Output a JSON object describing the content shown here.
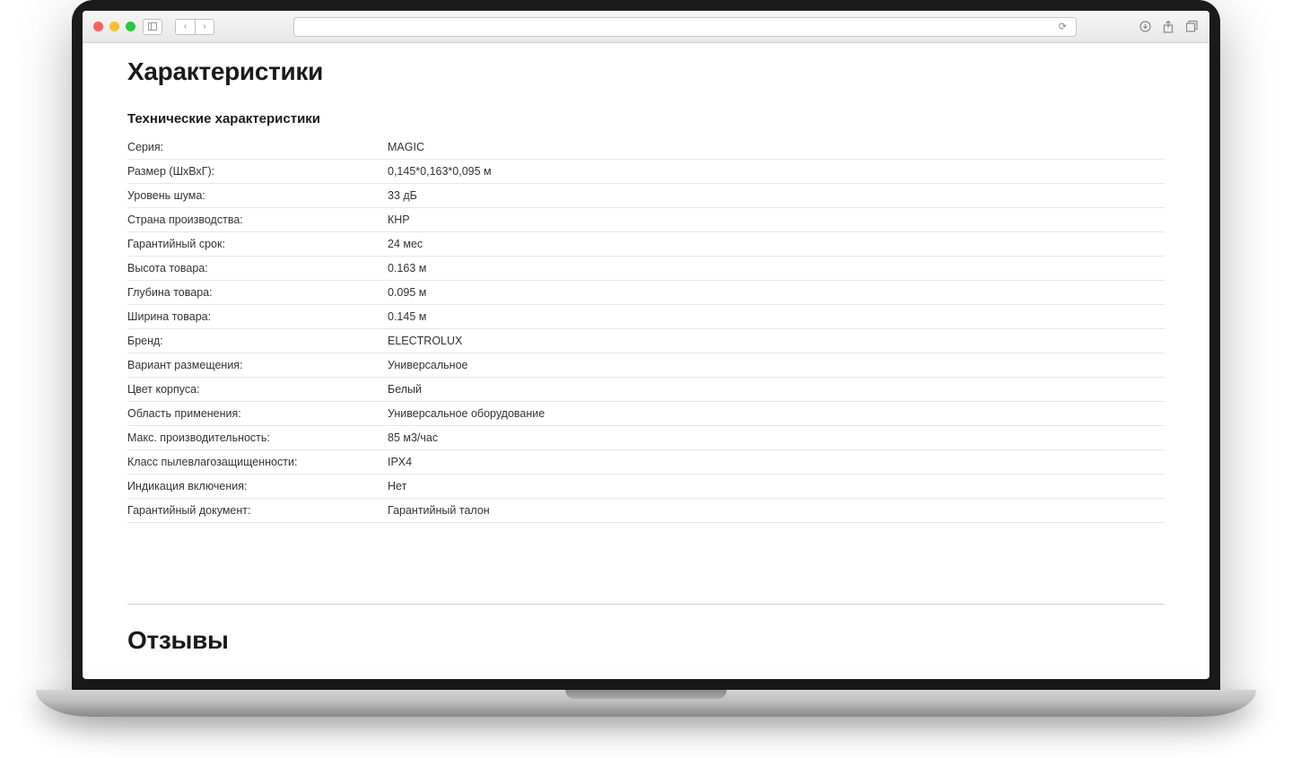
{
  "headings": {
    "main": "Характеристики",
    "sub": "Технические характеристики",
    "reviews": "Отзывы"
  },
  "specs": [
    {
      "label": "Серия:",
      "value": "MAGIC"
    },
    {
      "label": "Размер (ШхВхГ):",
      "value": "0,145*0,163*0,095 м"
    },
    {
      "label": "Уровень шума:",
      "value": "33 дБ"
    },
    {
      "label": "Страна производства:",
      "value": "КНР"
    },
    {
      "label": "Гарантийный срок:",
      "value": "24 мес"
    },
    {
      "label": "Высота товара:",
      "value": "0.163 м"
    },
    {
      "label": "Глубина товара:",
      "value": "0.095 м"
    },
    {
      "label": "Ширина товара:",
      "value": "0.145 м"
    },
    {
      "label": "Бренд:",
      "value": "ELECTROLUX"
    },
    {
      "label": "Вариант размещения:",
      "value": "Универсальное"
    },
    {
      "label": "Цвет корпуса:",
      "value": "Белый"
    },
    {
      "label": "Область применения:",
      "value": "Универсальное оборудование"
    },
    {
      "label": "Макс. производительность:",
      "value": "85 м3/час"
    },
    {
      "label": "Класс пылевлагозащищенности:",
      "value": "IPX4"
    },
    {
      "label": "Индикация включения:",
      "value": "Нет"
    },
    {
      "label": "Гарантийный документ:",
      "value": "Гарантийный талон"
    }
  ]
}
